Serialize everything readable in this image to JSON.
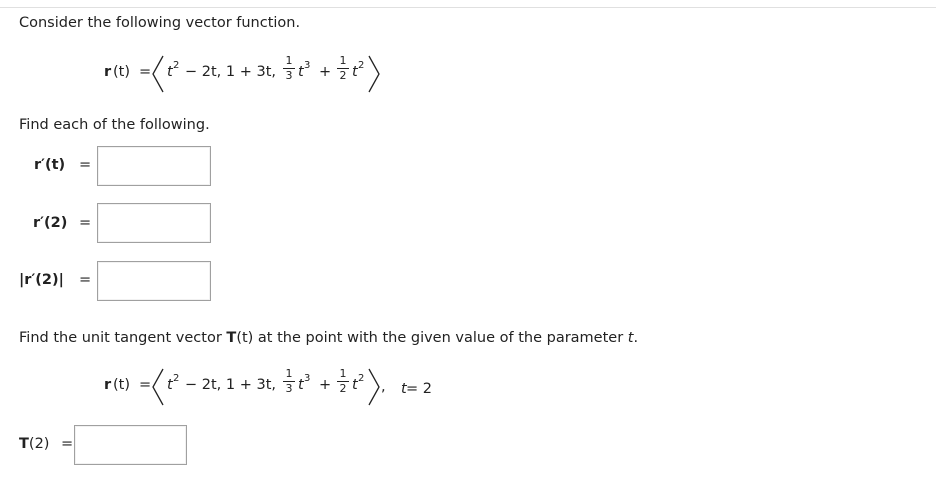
{
  "intro": "Consider the following vector function.",
  "func": {
    "lhs_r": "r",
    "lhs_t": "(t)",
    "eq": "=",
    "c1_base": "t",
    "c1_exp": "2",
    "c1_rest": "− 2t, 1 + 3t,",
    "f1_num": "1",
    "f1_den": "3",
    "c3_base": "t",
    "c3_exp": "3",
    "plus": "+",
    "f2_num": "1",
    "f2_den": "2",
    "c4_base": "t",
    "c4_exp": "2"
  },
  "find_each": "Find each of the following.",
  "q1": {
    "label": "r′(t)",
    "eq": "="
  },
  "q2": {
    "label": "r′(2)",
    "eq": "="
  },
  "q3": {
    "label": "|r′(2)|",
    "eq": "="
  },
  "tangent_prompt": {
    "pre": "Find the unit tangent vector ",
    "T": "T",
    "mid": "(t) at the point with the given value of the parameter ",
    "t": "t",
    "post": "."
  },
  "func2_suffix": {
    "comma": ",",
    "t": "t",
    "val": " = 2"
  },
  "q4": {
    "label_T": "T",
    "label_arg": "(2)",
    "eq": "="
  }
}
